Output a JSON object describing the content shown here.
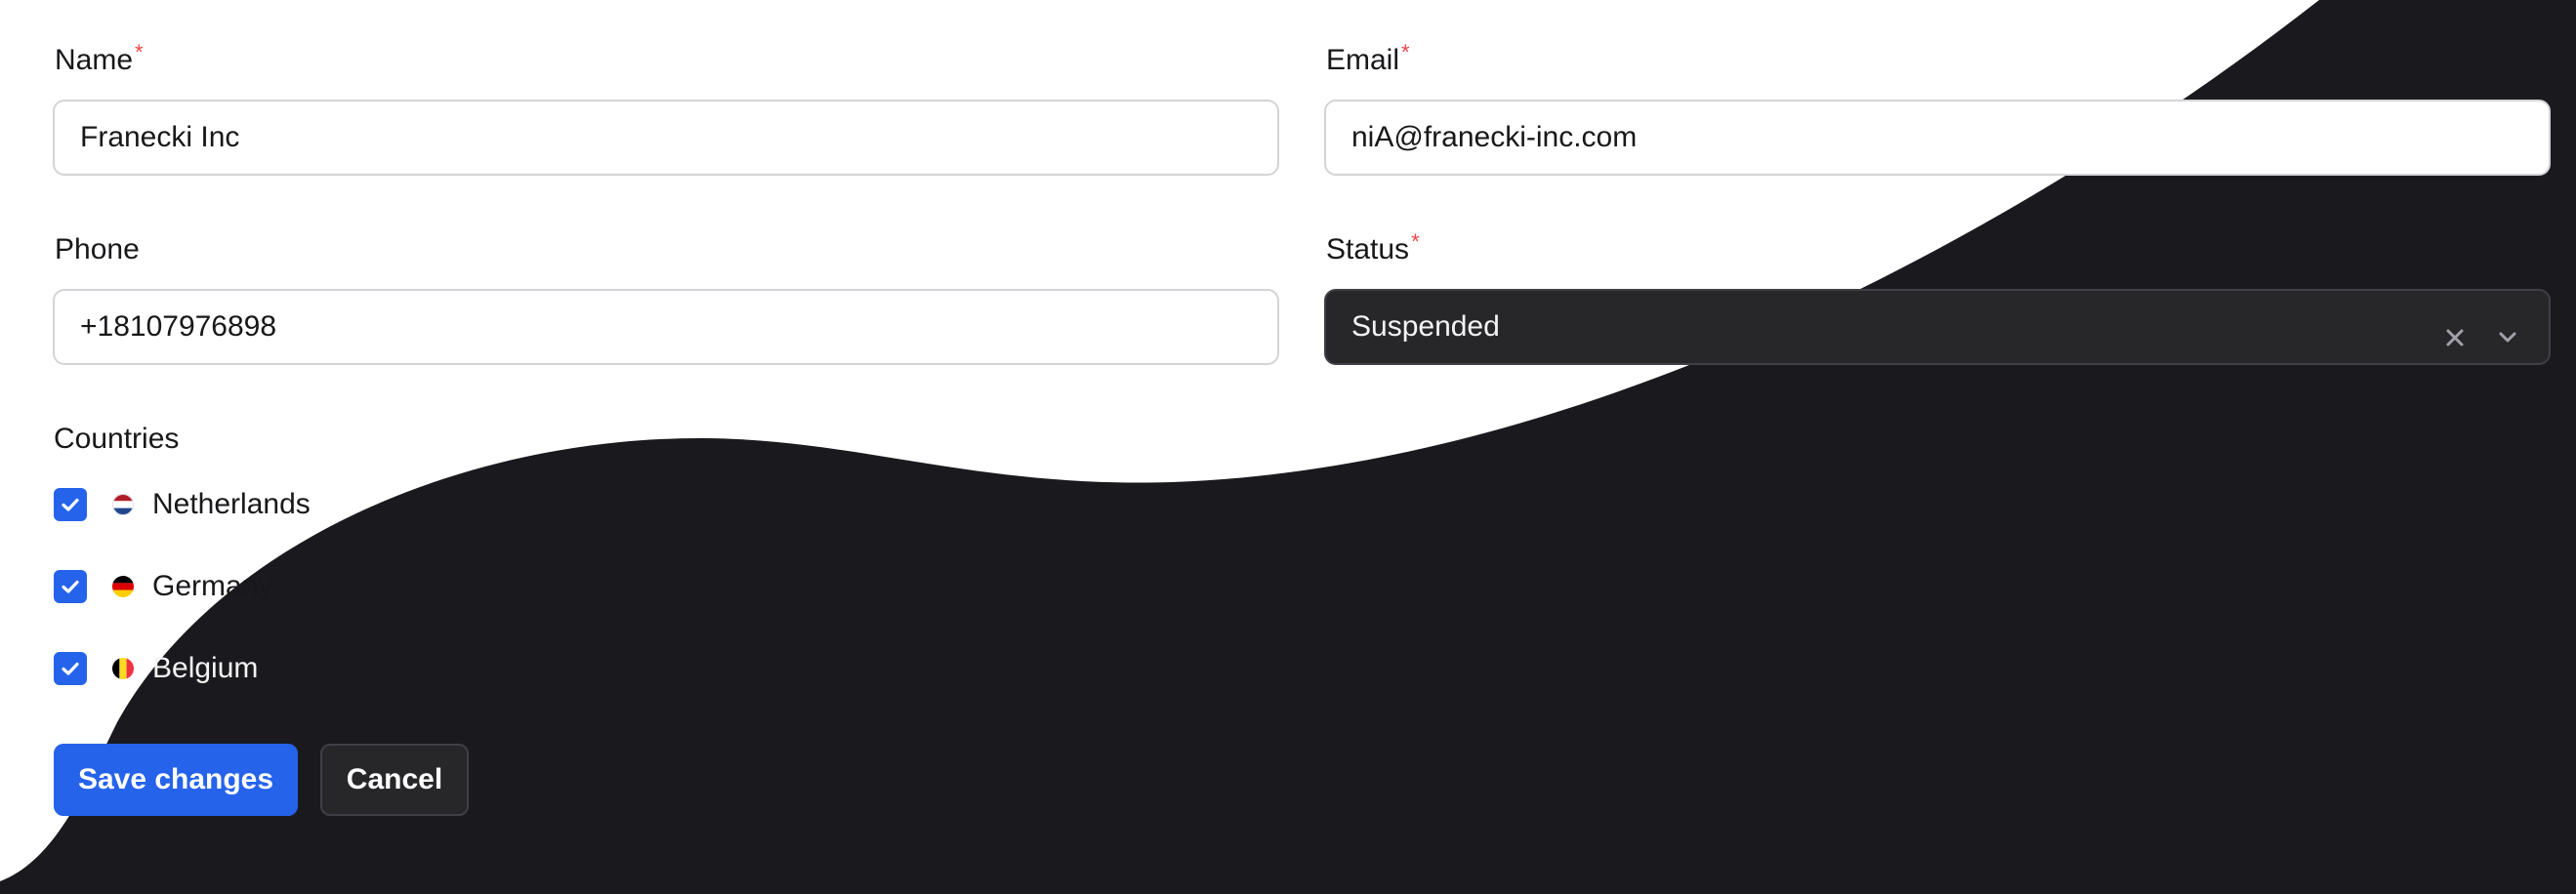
{
  "form": {
    "name": {
      "label": "Name",
      "required_mark": "*",
      "value": "Franecki Inc"
    },
    "email": {
      "label": "Email",
      "required_mark": "*",
      "value": "niA@franecki-inc.com"
    },
    "phone": {
      "label": "Phone",
      "value": "+18107976898"
    },
    "status": {
      "label": "Status",
      "required_mark": "*",
      "value": "Suspended",
      "clear_icon": "close-icon",
      "dropdown_icon": "chevron-down-icon"
    },
    "countries": {
      "label": "Countries",
      "items": [
        {
          "name": "Netherlands",
          "checked": true,
          "flag": "netherlands-flag-icon",
          "flag_colors": [
            "#ae1c28",
            "#ffffff",
            "#21468b"
          ]
        },
        {
          "name": "Germany",
          "checked": true,
          "flag": "germany-flag-icon",
          "flag_colors": [
            "#000000",
            "#dd0000",
            "#ffce00"
          ]
        },
        {
          "name": "Belgium",
          "checked": true,
          "flag": "belgium-flag-icon",
          "flag_colors": [
            "#000000",
            "#fdda24",
            "#ef3340"
          ]
        }
      ]
    }
  },
  "actions": {
    "save_label": "Save changes",
    "cancel_label": "Cancel"
  },
  "colors": {
    "primary": "#2563eb",
    "required": "#ef4444",
    "dark_background": "#18181b",
    "light_background": "#ffffff"
  }
}
